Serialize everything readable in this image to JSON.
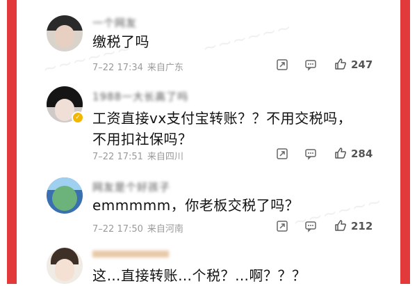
{
  "comments": [
    {
      "username": "一个网友",
      "text": "缴税了吗",
      "time": "7–22 17:34",
      "location": "来自广东",
      "likes": "247",
      "avatar": "avatar-woman"
    },
    {
      "username": "1988一大长高了吗",
      "text": "工资直接vx支付宝转账？？不用交税吗，不用扣社保吗？",
      "time": "7–22 17:51",
      "location": "来自四川",
      "likes": "284",
      "avatar": "avatar-woman-dark-hair"
    },
    {
      "username": "网友是个好孩子",
      "text": "emmmmm，你老板交税了吗？",
      "time": "7–22 17:50",
      "location": "来自河南",
      "likes": "212",
      "avatar": "avatar-cartoon"
    },
    {
      "username": "",
      "text": "这…直接转账…个税？…啊？？？",
      "avatar": "avatar-illustration"
    }
  ],
  "icons": {
    "share": "share-icon",
    "comment": "comment-icon",
    "like": "thumbs-up-icon"
  },
  "colors": {
    "frame": "#e23a3a",
    "meta": "#9a9a9a",
    "text": "#111111"
  }
}
